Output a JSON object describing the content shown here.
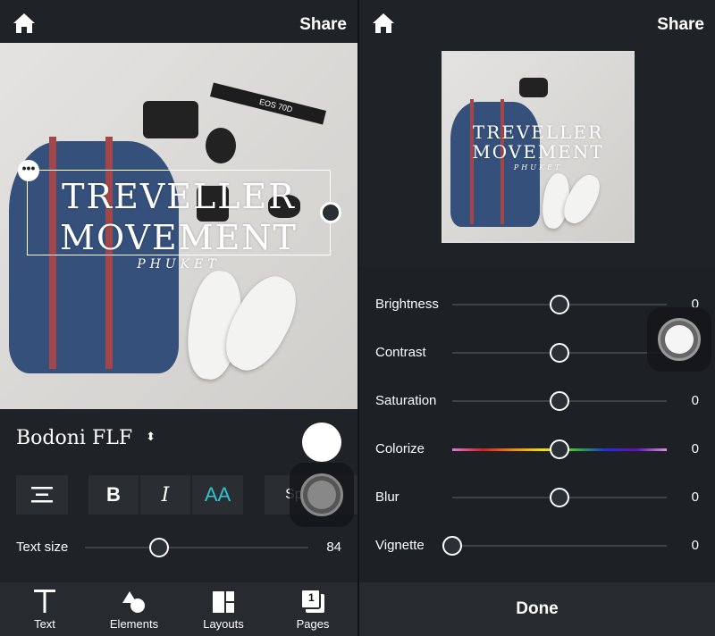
{
  "left": {
    "share_label": "Share",
    "overlay_text": {
      "line1": "TREVELLER",
      "line2": "MOVEMENT",
      "line3": "PHUKET"
    },
    "photo_label": "EOS 70D",
    "font_name": "Bodoni FLF",
    "text_color": "#ffffff",
    "accent_color": "#2ec4c9",
    "format_buttons": {
      "bold": "B",
      "italic": "I",
      "caps": "AA",
      "spacing": "Spacing"
    },
    "text_size": {
      "label": "Text size",
      "value": "84",
      "fraction": 0.33
    },
    "tabs": [
      {
        "label": "Text",
        "icon": "text-icon"
      },
      {
        "label": "Elements",
        "icon": "shapes-icon"
      },
      {
        "label": "Layouts",
        "icon": "layout-icon"
      },
      {
        "label": "Pages",
        "icon": "pages-icon",
        "badge": "1"
      }
    ]
  },
  "right": {
    "share_label": "Share",
    "sliders": [
      {
        "label": "Brightness",
        "value": "0",
        "fraction": 0.5
      },
      {
        "label": "Contrast",
        "value": "",
        "fraction": 0.5
      },
      {
        "label": "Saturation",
        "value": "0",
        "fraction": 0.5
      },
      {
        "label": "Colorize",
        "value": "0",
        "fraction": 0.5,
        "rainbow": true
      },
      {
        "label": "Blur",
        "value": "0",
        "fraction": 0.5
      },
      {
        "label": "Vignette",
        "value": "0",
        "fraction": 0.0
      }
    ],
    "done_label": "Done"
  }
}
